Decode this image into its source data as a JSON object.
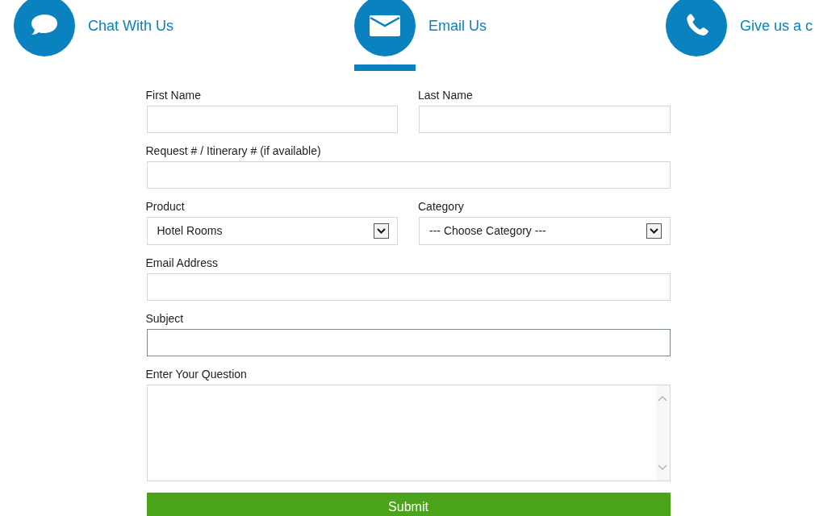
{
  "contact_tabs": [
    {
      "kind": "chat",
      "label": "Chat With Us",
      "selected": false
    },
    {
      "kind": "email",
      "label": "Email Us",
      "selected": true
    },
    {
      "kind": "phone",
      "label": "Give us a c",
      "selected": false
    }
  ],
  "form": {
    "rows": [
      [
        {
          "kind": "text",
          "label": "First Name",
          "focused": false
        },
        {
          "kind": "text",
          "label": "Last Name",
          "focused": false
        }
      ],
      [
        {
          "kind": "text",
          "label": "Request # / Itinerary # (if available)",
          "focused": false
        }
      ],
      [
        {
          "kind": "select",
          "label": "Product",
          "value": "Hotel Rooms",
          "focused": false
        },
        {
          "kind": "select",
          "label": "Category",
          "value": "--- Choose Category ---",
          "focused": false
        }
      ],
      [
        {
          "kind": "text",
          "label": "Email Address",
          "focused": false
        }
      ],
      [
        {
          "kind": "text",
          "label": "Subject",
          "focused": true
        }
      ],
      [
        {
          "kind": "textarea",
          "label": "Enter Your Question",
          "focused": false
        }
      ]
    ],
    "submit": "Submit"
  }
}
